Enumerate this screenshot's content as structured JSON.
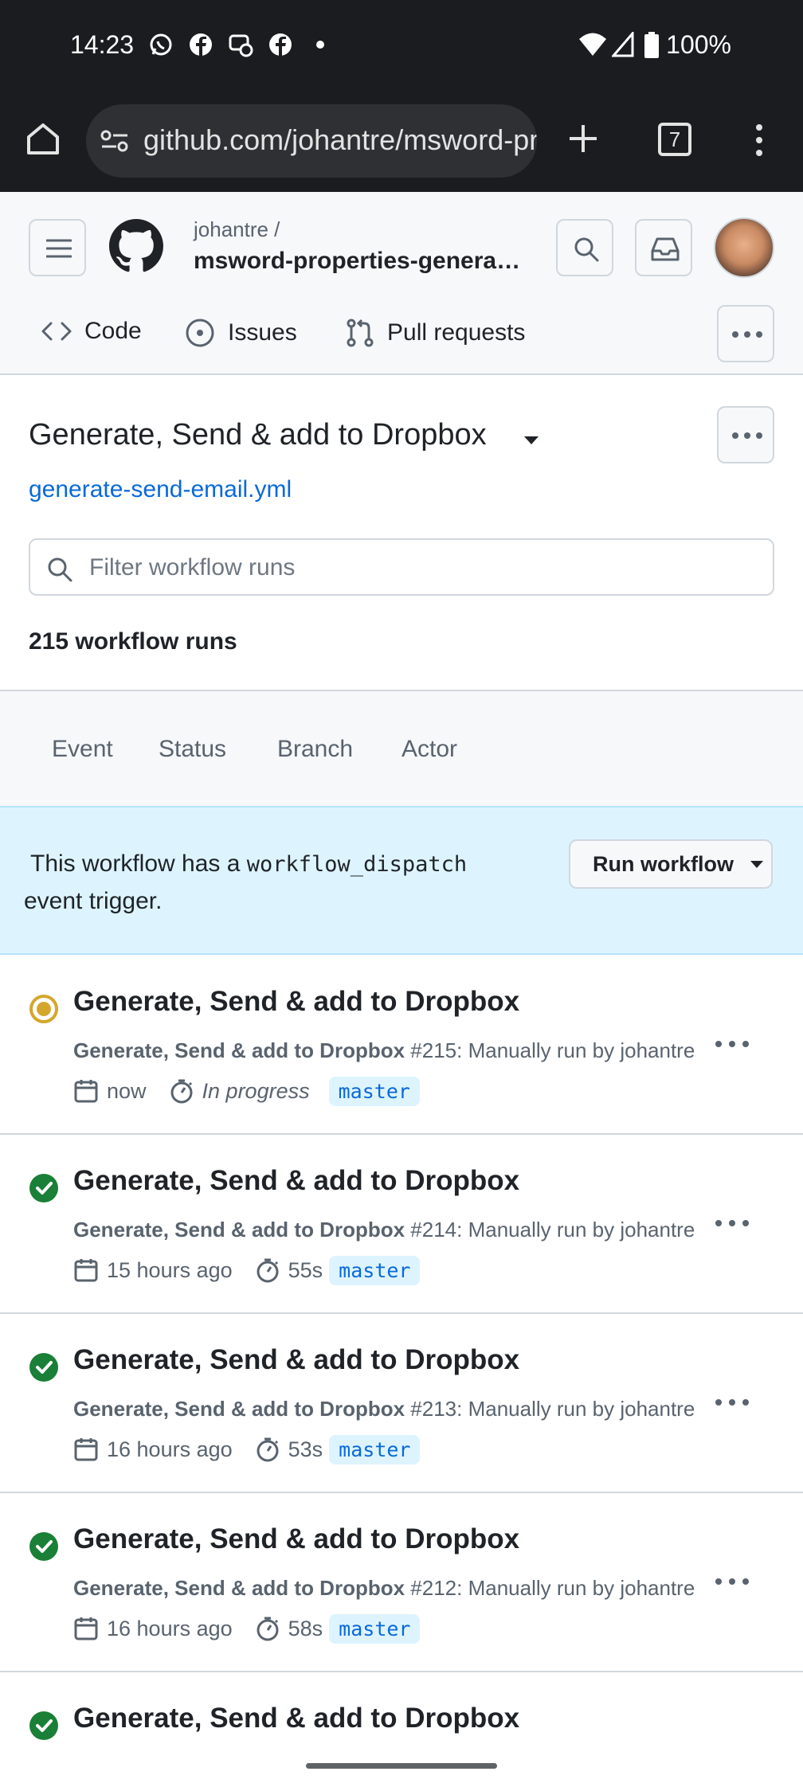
{
  "status_bar": {
    "time": "14:23",
    "battery": "100%",
    "notification_icons": [
      "whatsapp-icon",
      "facebook-icon",
      "messenger-icon",
      "facebook-icon",
      "dot-icon"
    ]
  },
  "browser": {
    "url": "github.com/johantre/msword-properties-generator",
    "tab_count": "7"
  },
  "header": {
    "owner": "johantre /",
    "repo": "msword-properties-genera…",
    "tabs": [
      {
        "label": "Code",
        "icon": "code-icon"
      },
      {
        "label": "Issues",
        "icon": "issue-icon"
      },
      {
        "label": "Pull requests",
        "icon": "pull-request-icon"
      }
    ]
  },
  "workflow": {
    "title": "Generate, Send & add to Dropbox",
    "file": "generate-send-email.yml",
    "filter_placeholder": "Filter workflow runs",
    "run_count": "215 workflow runs"
  },
  "filters": [
    "Event",
    "Status",
    "Branch",
    "Actor"
  ],
  "banner": {
    "text_before": "This workflow has a ",
    "code": "workflow_dispatch",
    "text_after": " event trigger.",
    "button": "Run workflow"
  },
  "runs": [
    {
      "title": "Generate, Send & add to Dropbox",
      "workflow": "Generate, Send & add to Dropbox",
      "detail": " #215: Manually run by johantre",
      "time": "now",
      "duration": "In progress",
      "branch": "master",
      "status": "in_progress"
    },
    {
      "title": "Generate, Send & add to Dropbox",
      "workflow": "Generate, Send & add to Dropbox",
      "detail": " #214: Manually run by johantre",
      "time": "15 hours ago",
      "duration": "55s",
      "branch": "master",
      "status": "success"
    },
    {
      "title": "Generate, Send & add to Dropbox",
      "workflow": "Generate, Send & add to Dropbox",
      "detail": " #213: Manually run by johantre",
      "time": "16 hours ago",
      "duration": "53s",
      "branch": "master",
      "status": "success"
    },
    {
      "title": "Generate, Send & add to Dropbox",
      "workflow": "Generate, Send & add to Dropbox",
      "detail": " #212: Manually run by johantre",
      "time": "16 hours ago",
      "duration": "58s",
      "branch": "master",
      "status": "success"
    },
    {
      "title": "Generate, Send & add to Dropbox",
      "status": "success"
    }
  ],
  "colors": {
    "success": "#1a7f37",
    "in_progress": "#d4a72c",
    "link": "#0969da"
  }
}
